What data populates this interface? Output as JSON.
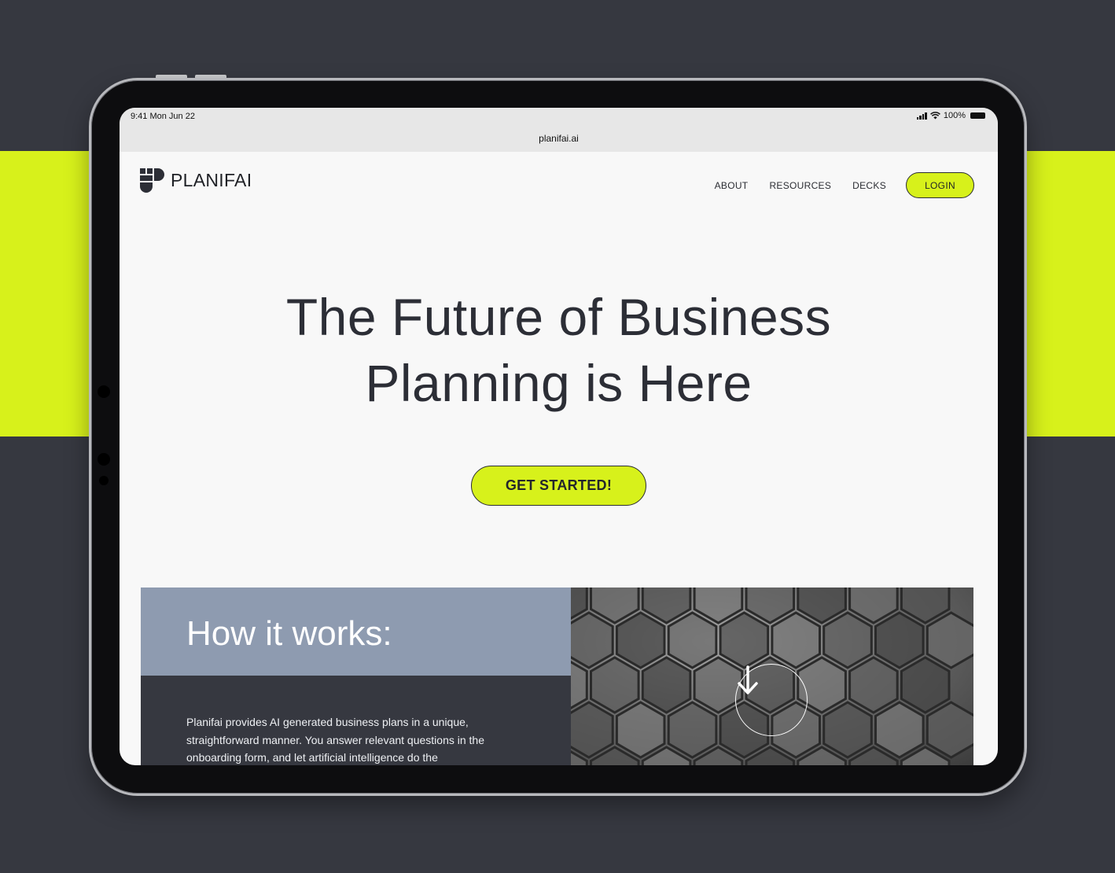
{
  "colors": {
    "accent": "#d7f11b",
    "dark": "#363840",
    "slate": "#8e9bb0",
    "text": "#2c2e36"
  },
  "status_bar": {
    "time": "9:41  Mon Jun 22",
    "battery": "100%"
  },
  "url_bar": {
    "url": "planifai.ai"
  },
  "nav": {
    "brand": "PLANIFAI",
    "items": [
      {
        "label": "ABOUT"
      },
      {
        "label": "RESOURCES"
      },
      {
        "label": "DECKS"
      }
    ],
    "login_label": "LOGIN"
  },
  "hero": {
    "title_line1": "The Future of Business",
    "title_line2": "Planning is Here",
    "cta_label": "GET STARTED!"
  },
  "how_it_works": {
    "title": "How it works:",
    "body": "Planifai provides AI generated business plans in a unique, straightforward manner.  You answer relevant questions in the onboarding form, and let artificial intelligence do the"
  },
  "icons": {
    "logo": "planifai-logo-icon",
    "scroll": "arrow-down-icon",
    "signal": "signal-icon",
    "wifi": "wifi-icon",
    "battery": "battery-icon"
  }
}
